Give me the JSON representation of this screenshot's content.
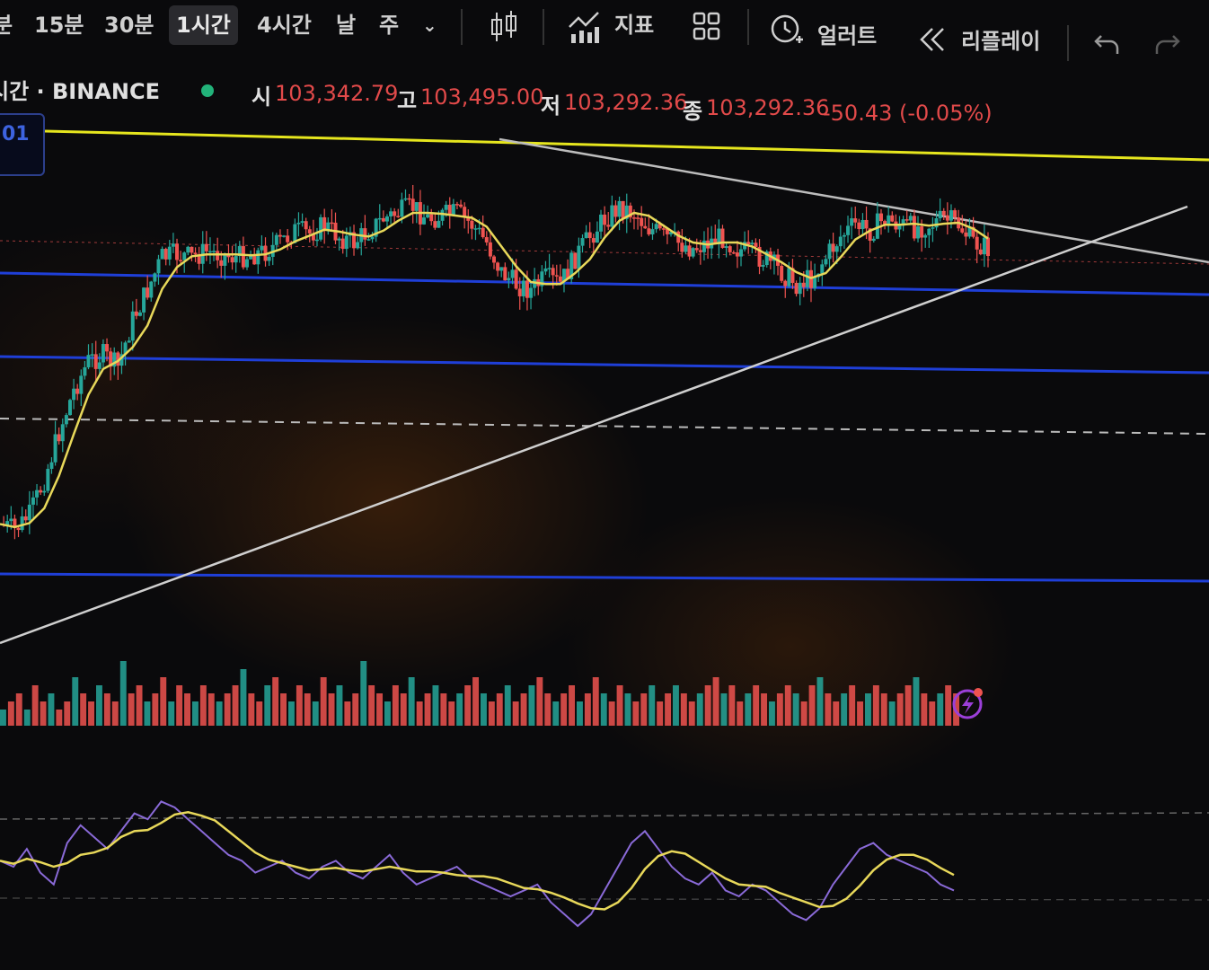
{
  "toolbar": {
    "intervals": [
      "분",
      "15분",
      "30분",
      "1시간",
      "4시간",
      "날",
      "주"
    ],
    "active_interval": "1시간",
    "chart_type_icon": "candles-icon",
    "indicators_label": "지표",
    "layouts_icon": "layout-grid-icon",
    "alert_label": "얼러트",
    "replay_label": "리플레이",
    "undo_icon": "undo-icon",
    "redo_icon": "redo-icon"
  },
  "legend": {
    "symbol": "시간 · BINANCE",
    "status_color": "#22b37a",
    "open_label": "시",
    "open": "103,342.79",
    "high_label": "고",
    "high": "103,495.00",
    "low_label": "저",
    "low": "103,292.36",
    "close_label": "종",
    "close": "103,292.36",
    "change": "-50.43 (-0.05%)"
  },
  "price_badge": "01",
  "colors": {
    "up": "#26a69a",
    "down": "#ef5350",
    "ma": "#e8d85a",
    "yellow_line": "#e6e61e",
    "blue_line": "#1f3fd8",
    "trend_line": "#cfcfcf",
    "rsi": "#8a6ad8",
    "rsi_ma": "#e8d85a"
  },
  "chart_data": {
    "type": "line",
    "title": "",
    "xlabel": "",
    "ylabel": "",
    "series": [
      {
        "values": [
          0.05,
          0.03,
          0.08,
          0.2,
          0.36,
          0.5,
          0.6,
          0.62,
          0.58,
          0.74,
          0.84,
          0.95,
          0.96,
          0.95,
          0.97,
          0.96,
          0.95,
          0.96,
          0.97,
          1.0,
          1.04,
          1.03,
          1.06,
          1.02,
          1.0,
          1.04,
          1.08,
          1.1,
          1.12,
          1.08,
          1.09,
          1.1,
          1.06,
          1.0,
          0.9,
          0.86,
          0.84,
          0.88,
          0.86,
          0.95,
          1.02,
          1.08,
          1.12,
          1.1,
          1.05,
          1.02,
          1.0,
          0.98,
          1.0,
          1.02,
          0.98,
          0.96,
          0.94,
          0.9,
          0.86,
          0.88,
          0.95,
          1.02,
          1.06,
          1.04,
          1.08,
          1.06,
          1.05,
          1.06,
          1.08,
          1.06,
          1.0,
          0.98
        ]
      }
    ],
    "volume_values": [
      2,
      3,
      4,
      2,
      5,
      3,
      4,
      2,
      3,
      6,
      4,
      3,
      5,
      4,
      3,
      8,
      4,
      5,
      3,
      4,
      6,
      3,
      5,
      4,
      3,
      5,
      4,
      3,
      4,
      5,
      7,
      4,
      3,
      5,
      6,
      4,
      3,
      5,
      4,
      3,
      6,
      4,
      5,
      3,
      4,
      8,
      5,
      4,
      3,
      5,
      4,
      6,
      3,
      4,
      5,
      4,
      3,
      4,
      5,
      6,
      4,
      3,
      4,
      5,
      3,
      4,
      5,
      6,
      4,
      3,
      4,
      5,
      3,
      4,
      6,
      4,
      3,
      5,
      4,
      3,
      4,
      5,
      3,
      4,
      5,
      4,
      3,
      4,
      5,
      6,
      4,
      5,
      3,
      4,
      5,
      4,
      3,
      4,
      5,
      4,
      3,
      5,
      6,
      4,
      3,
      4,
      5,
      3,
      4,
      5,
      4,
      3,
      4,
      5,
      6,
      4,
      3,
      4,
      5,
      4
    ],
    "rsi_values": [
      52,
      50,
      56,
      48,
      44,
      58,
      64,
      60,
      56,
      62,
      68,
      66,
      72,
      70,
      66,
      62,
      58,
      54,
      52,
      48,
      50,
      52,
      48,
      46,
      50,
      52,
      48,
      46,
      50,
      54,
      48,
      44,
      46,
      48,
      50,
      46,
      44,
      42,
      40,
      42,
      44,
      38,
      34,
      30,
      34,
      42,
      50,
      58,
      62,
      56,
      50,
      46,
      44,
      48,
      42,
      40,
      44,
      42,
      38,
      34,
      32,
      36,
      44,
      50,
      56,
      58,
      54,
      52,
      50,
      48,
      44,
      42
    ]
  }
}
